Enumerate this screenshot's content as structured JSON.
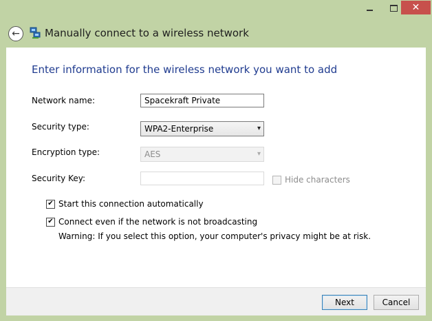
{
  "window": {
    "title": "Manually connect to a wireless network",
    "controls": {
      "minimize": "—",
      "maximize": "□",
      "close": "✕"
    }
  },
  "heading": "Enter information for the wireless network you want to add",
  "form": {
    "network_name": {
      "label": "Network name:",
      "value": "Spacekraft Private"
    },
    "security_type": {
      "label": "Security type:",
      "value": "WPA2-Enterprise"
    },
    "encryption_type": {
      "label": "Encryption type:",
      "value": "AES",
      "disabled": true
    },
    "security_key": {
      "label": "Security Key:",
      "value": "",
      "disabled": true
    },
    "hide_characters": {
      "label": "Hide characters",
      "checked": false,
      "disabled": true
    }
  },
  "options": {
    "start_auto": {
      "label": "Start this connection automatically",
      "checked": true
    },
    "connect_not_broadcasting": {
      "label": "Connect even if the network is not broadcasting",
      "checked": true
    },
    "warning": "Warning: If you select this option, your computer's privacy might be at risk."
  },
  "buttons": {
    "next": "Next",
    "cancel": "Cancel"
  },
  "colors": {
    "frame": "#c1d3a5",
    "heading": "#1f3b8f",
    "close": "#c7504c"
  },
  "icons": {
    "back": "back-arrow-icon",
    "network": "network-icon",
    "checkmark": "✔",
    "dropdown": "▾"
  }
}
